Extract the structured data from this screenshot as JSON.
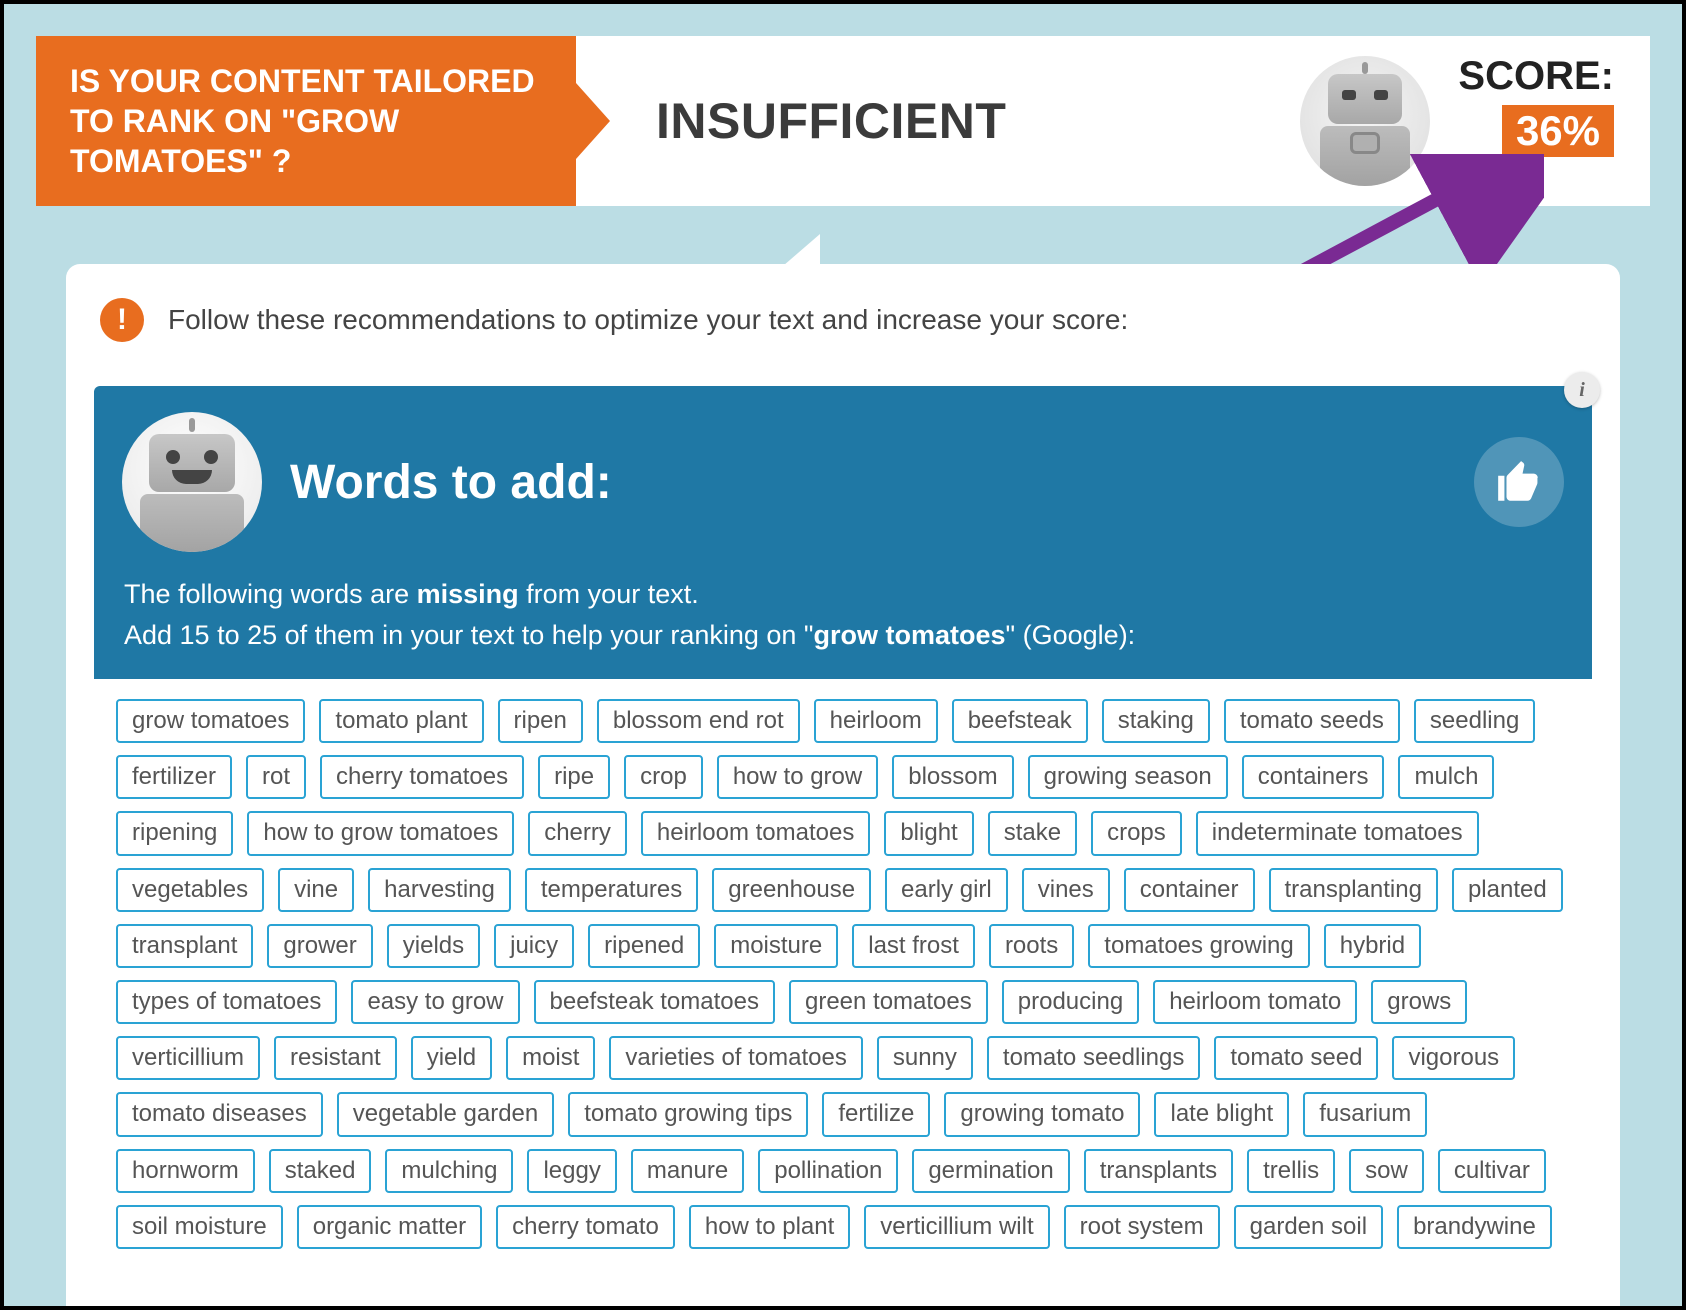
{
  "banner": {
    "question": "IS YOUR CONTENT TAILORED TO RANK ON \"GROW TOMATOES\" ?",
    "status": "INSUFFICIENT",
    "score_label": "SCORE:",
    "score_value": "36%"
  },
  "recommendation": {
    "text": "Follow these recommendations to optimize your text and increase your score:"
  },
  "panel": {
    "title": "Words to add:",
    "desc_prefix": "The following words are ",
    "desc_bold1": "missing",
    "desc_mid1": " from your text.",
    "desc_line2a": "Add 15 to 25 of them in your text to help your ranking on \"",
    "desc_bold2": "grow tomatoes",
    "desc_line2b": "\" (Google):",
    "info_label": "i"
  },
  "tags": [
    "grow tomatoes",
    "tomato plant",
    "ripen",
    "blossom end rot",
    "heirloom",
    "beefsteak",
    "staking",
    "tomato seeds",
    "seedling",
    "fertilizer",
    "rot",
    "cherry tomatoes",
    "ripe",
    "crop",
    "how to grow",
    "blossom",
    "growing season",
    "containers",
    "mulch",
    "ripening",
    "how to grow tomatoes",
    "cherry",
    "heirloom tomatoes",
    "blight",
    "stake",
    "crops",
    "indeterminate tomatoes",
    "vegetables",
    "vine",
    "harvesting",
    "temperatures",
    "greenhouse",
    "early girl",
    "vines",
    "container",
    "transplanting",
    "planted",
    "transplant",
    "grower",
    "yields",
    "juicy",
    "ripened",
    "moisture",
    "last frost",
    "roots",
    "tomatoes growing",
    "hybrid",
    "types of tomatoes",
    "easy to grow",
    "beefsteak tomatoes",
    "green tomatoes",
    "producing",
    "heirloom tomato",
    "grows",
    "verticillium",
    "resistant",
    "yield",
    "moist",
    "varieties of tomatoes",
    "sunny",
    "tomato seedlings",
    "tomato seed",
    "vigorous",
    "tomato diseases",
    "vegetable garden",
    "tomato growing tips",
    "fertilize",
    "growing tomato",
    "late blight",
    "fusarium",
    "hornworm",
    "staked",
    "mulching",
    "leggy",
    "manure",
    "pollination",
    "germination",
    "transplants",
    "trellis",
    "sow",
    "cultivar",
    "soil moisture",
    "organic matter",
    "cherry tomato",
    "how to plant",
    "verticillium wilt",
    "root system",
    "garden soil",
    "brandywine"
  ]
}
